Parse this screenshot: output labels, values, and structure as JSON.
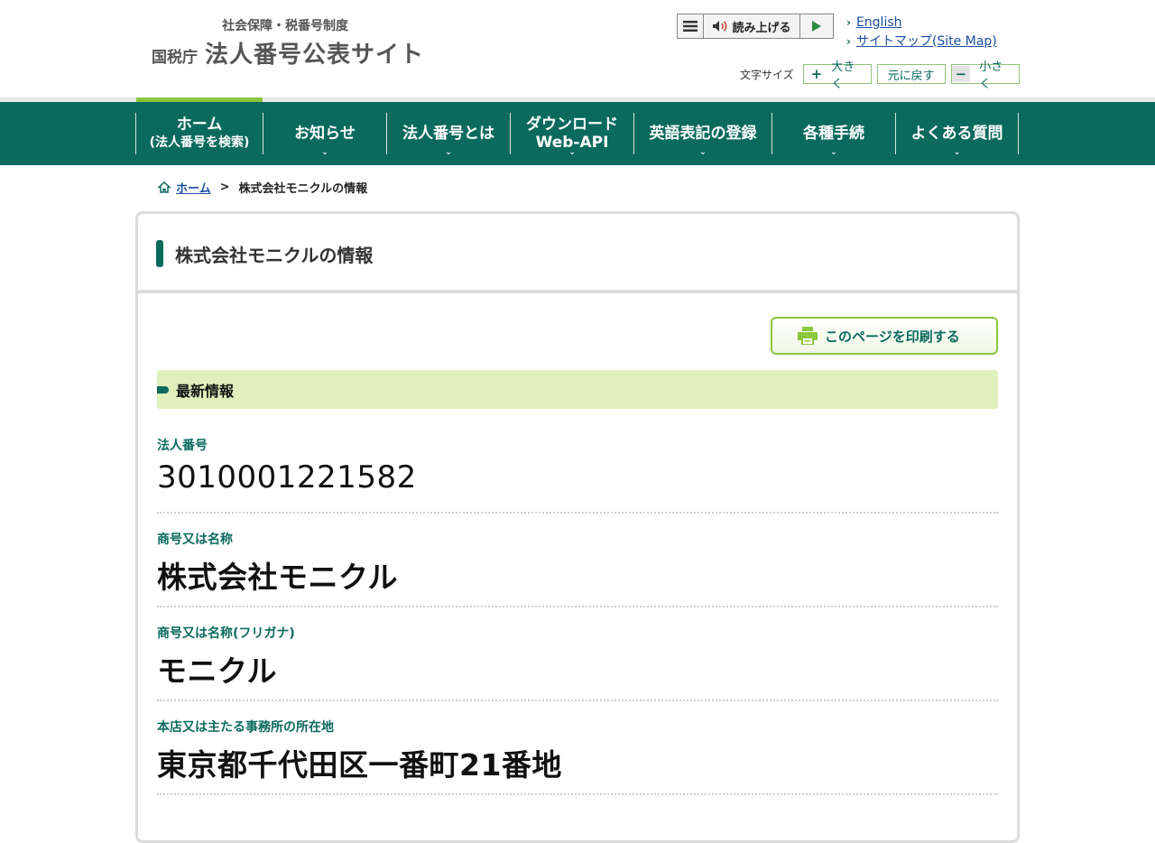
{
  "header": {
    "subtitle": "社会保障・税番号制度",
    "agency": "国税庁",
    "site_title": "法人番号公表サイト",
    "reader_label": "読み上げる",
    "links": [
      {
        "label": "English"
      },
      {
        "label": "サイトマップ(Site Map)"
      }
    ],
    "font_size": {
      "label": "文字サイズ",
      "larger": "大きく",
      "reset": "元に戻す",
      "smaller": "小さく"
    }
  },
  "nav": {
    "items": [
      {
        "line1": "ホーム",
        "line2": "(法人番号を検索)"
      },
      {
        "line1": "お知らせ"
      },
      {
        "line1": "法人番号とは"
      },
      {
        "line1": "ダウンロード",
        "line2": "Web-API"
      },
      {
        "line1": "英語表記の登録"
      },
      {
        "line1": "各種手続"
      },
      {
        "line1": "よくある質問"
      }
    ]
  },
  "breadcrumb": {
    "home": "ホーム",
    "separator": ">",
    "current": "株式会社モニクルの情報"
  },
  "panel": {
    "title": "株式会社モニクルの情報",
    "print_label": "このページを印刷する",
    "section_title": "最新情報",
    "fields": [
      {
        "label": "法人番号",
        "value": "3010001221582"
      },
      {
        "label": "商号又は名称",
        "value": "株式会社モニクル"
      },
      {
        "label": "商号又は名称(フリガナ)",
        "value": "モニクル"
      },
      {
        "label": "本店又は主たる事務所の所在地",
        "value": "東京都千代田区一番町21番地"
      }
    ]
  },
  "colors": {
    "brand_green": "#0b6a5e",
    "accent_lime": "#8cc63f",
    "section_bg": "#e0f0bc",
    "link_blue": "#1a4d9e"
  }
}
